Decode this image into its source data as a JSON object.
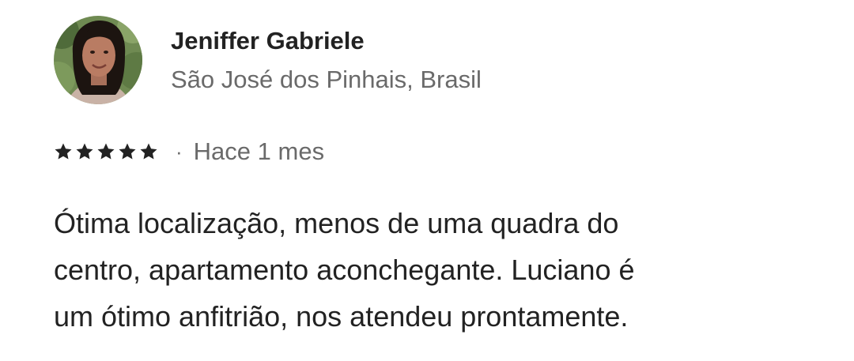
{
  "reviewer": {
    "name": "Jeniffer Gabriele",
    "location": "São José dos Pinhais, Brasil",
    "avatar_icon": "reviewer-photo"
  },
  "rating": {
    "stars": 5,
    "max": 5,
    "icon": "star-icon",
    "color": "#222222"
  },
  "separator": "·",
  "date": "Hace 1 mes",
  "review_text": {
    "lines": [
      "Ótima localização, menos de uma quadra do",
      "centro, apartamento aconchegante. Luciano é",
      "um ótimo anfitrião, nos atendeu prontamente."
    ]
  },
  "colors": {
    "primary_text": "#222222",
    "secondary_text": "#6a6a6a",
    "background": "#ffffff"
  }
}
